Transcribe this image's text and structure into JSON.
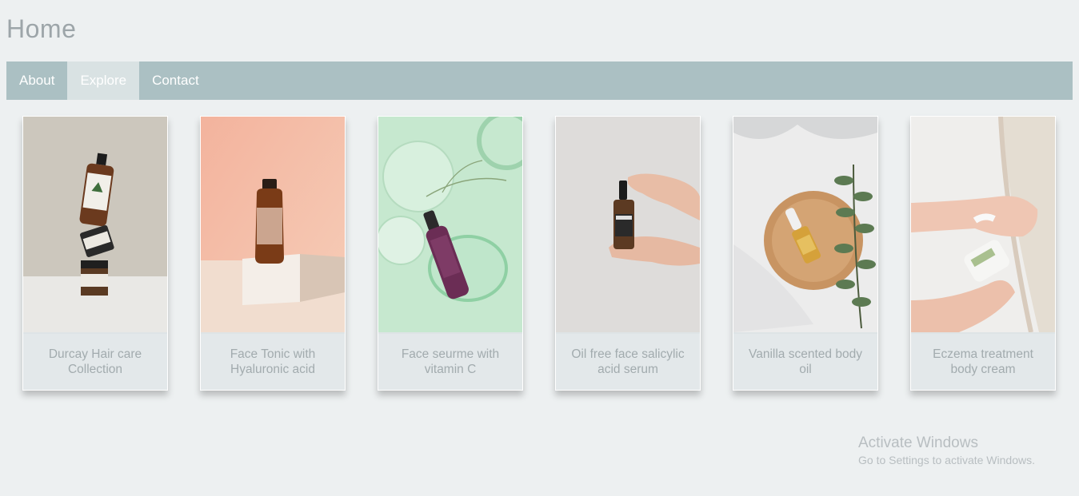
{
  "page": {
    "title": "Home"
  },
  "nav": {
    "items": [
      {
        "label": "About"
      },
      {
        "label": "Explore"
      },
      {
        "label": "Contact"
      }
    ]
  },
  "products": [
    {
      "caption": "Durcay Hair care Collection"
    },
    {
      "caption": "Face Tonic with Hyaluronic acid"
    },
    {
      "caption": "Face seurme with vitamin C"
    },
    {
      "caption": "Oil free face salicylic acid serum"
    },
    {
      "caption": "Vanilla scented body oil"
    },
    {
      "caption": "Eczema treatment body cream"
    }
  ],
  "watermark": {
    "title": "Activate Windows",
    "subtitle": "Go to Settings to activate Windows."
  },
  "colors": {
    "background": "#edf0f1",
    "navbar": "#abc0c3",
    "nav_active": "#d9e2e3",
    "caption_bg": "#e3e8ea"
  }
}
